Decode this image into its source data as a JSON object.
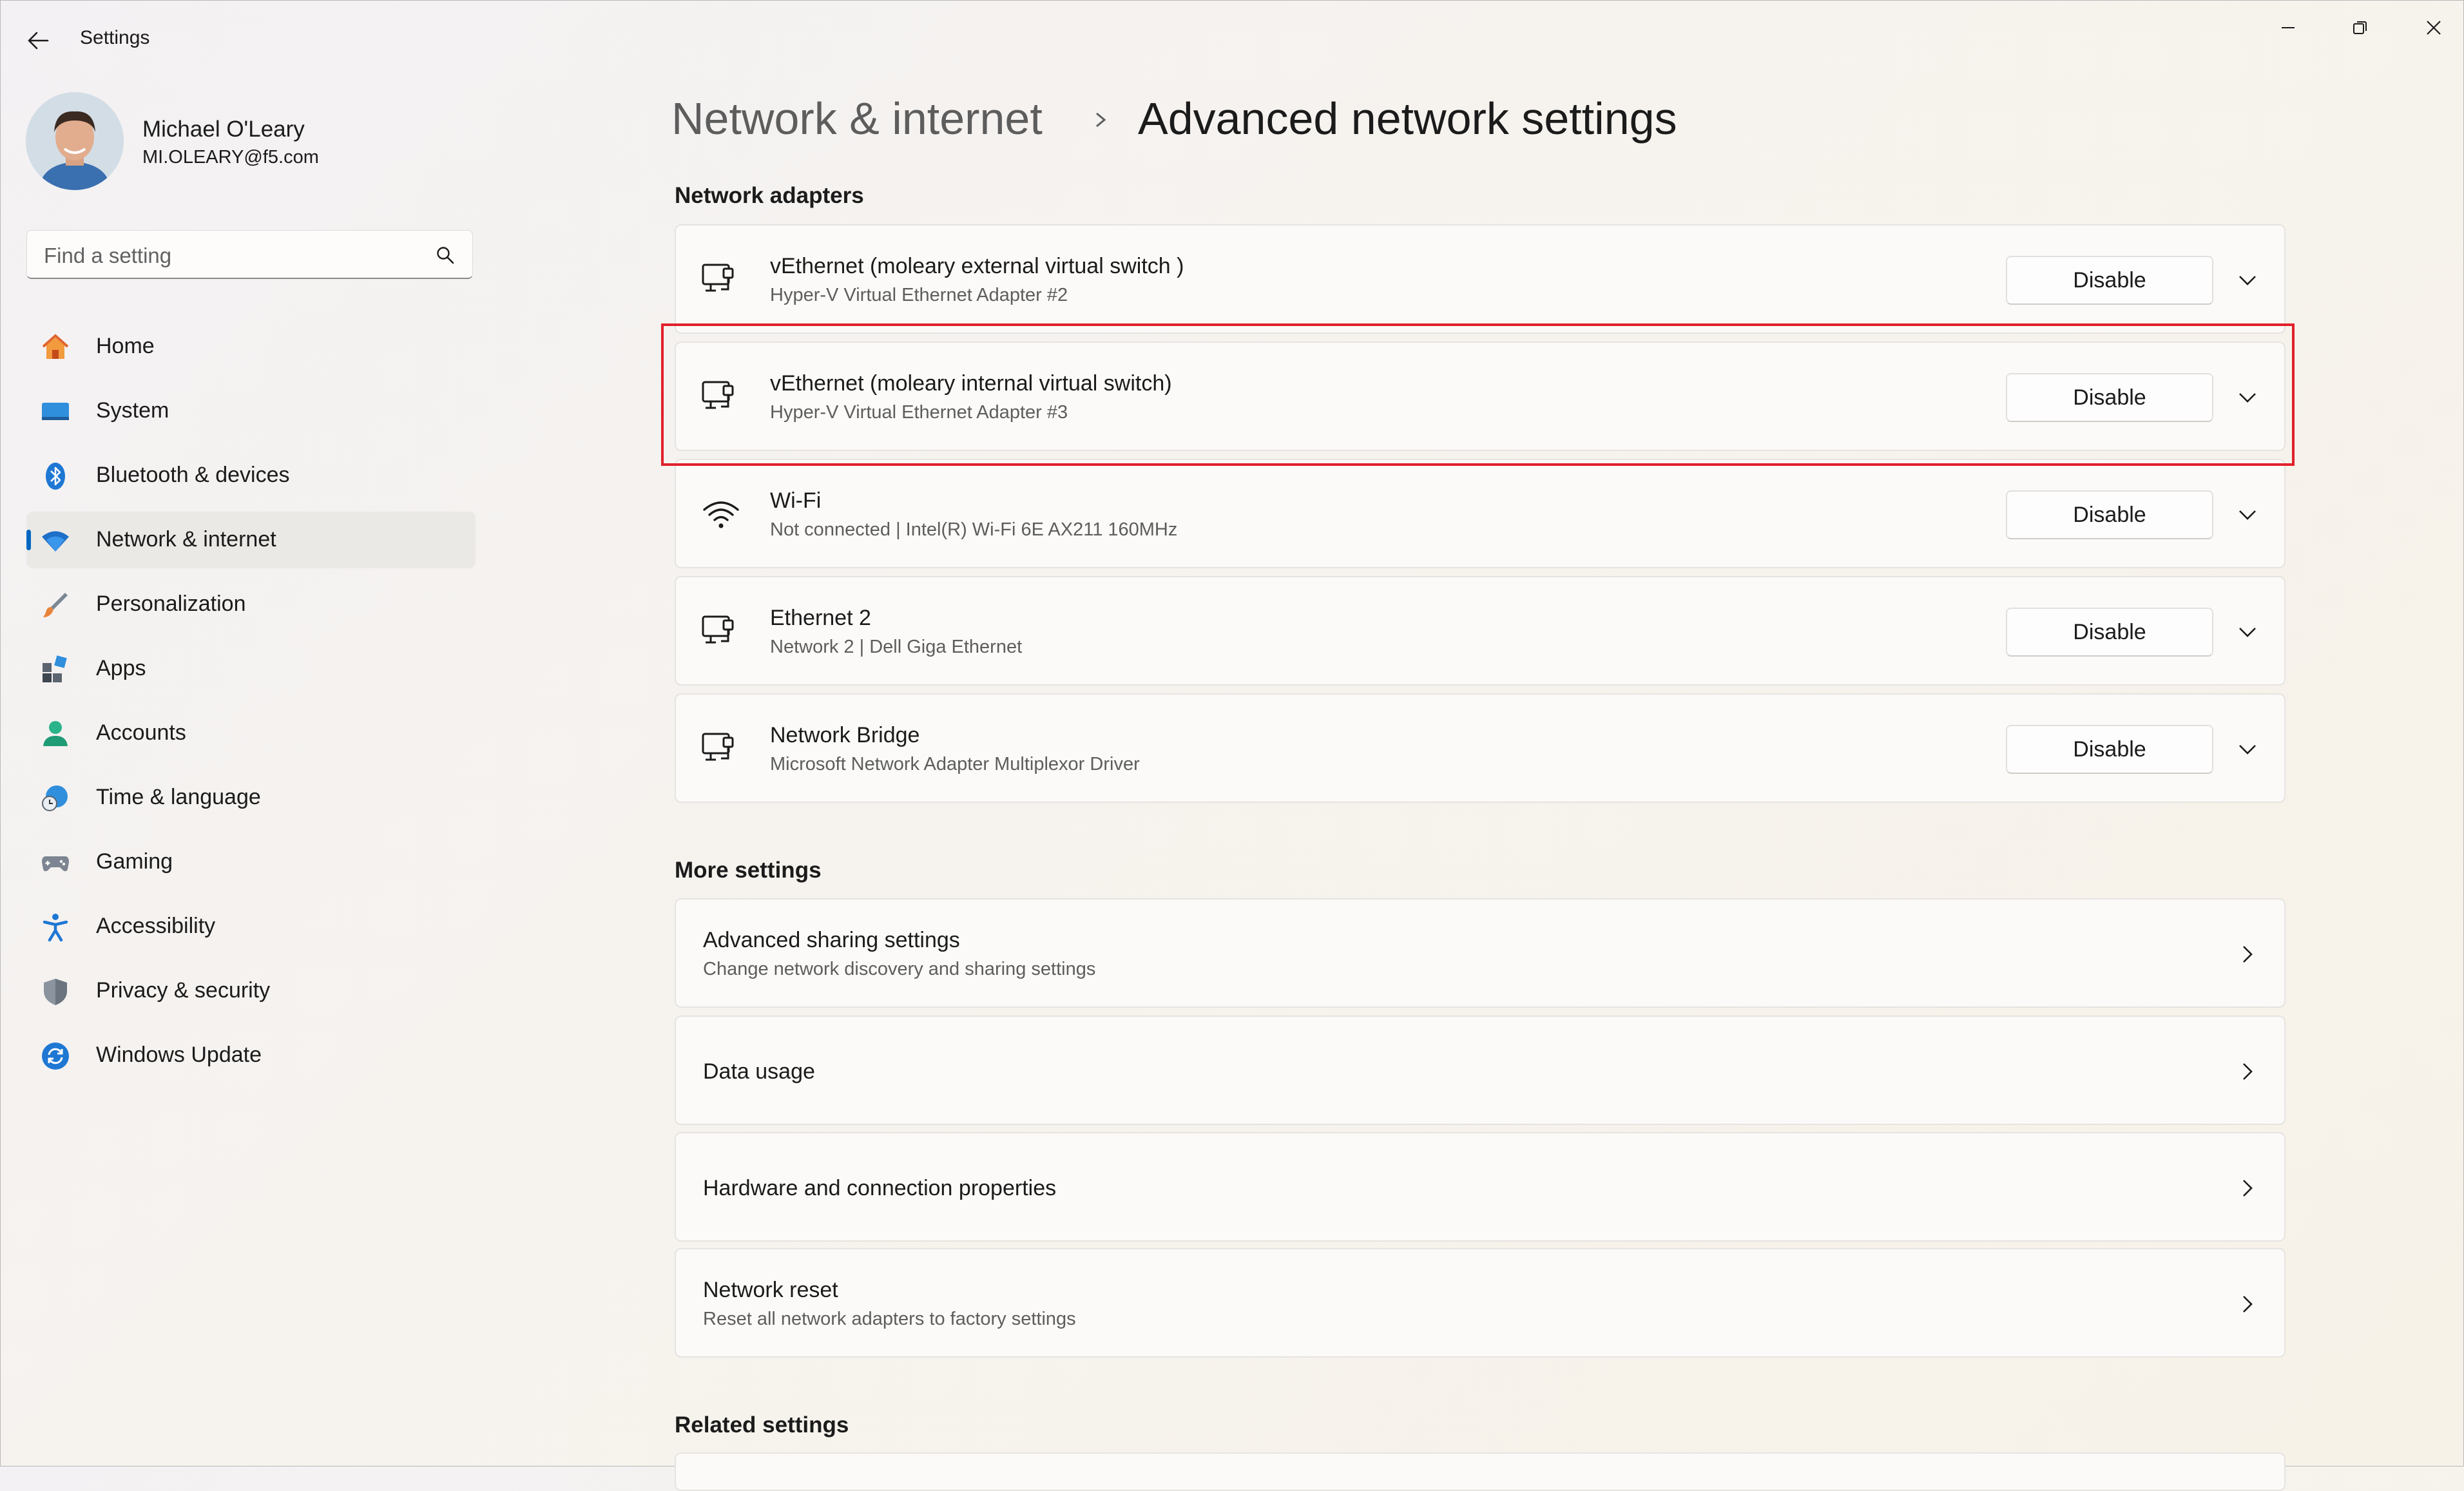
{
  "app": {
    "title": "Settings"
  },
  "user": {
    "name": "Michael O'Leary",
    "email": "MI.OLEARY@f5.com"
  },
  "search": {
    "placeholder": "Find a setting"
  },
  "nav": [
    {
      "label": "Home",
      "icon": "home-icon"
    },
    {
      "label": "System",
      "icon": "system-icon"
    },
    {
      "label": "Bluetooth & devices",
      "icon": "bluetooth-icon"
    },
    {
      "label": "Network & internet",
      "icon": "wifi-icon",
      "selected": true
    },
    {
      "label": "Personalization",
      "icon": "brush-icon"
    },
    {
      "label": "Apps",
      "icon": "apps-icon"
    },
    {
      "label": "Accounts",
      "icon": "accounts-icon"
    },
    {
      "label": "Time & language",
      "icon": "globe-clock-icon"
    },
    {
      "label": "Gaming",
      "icon": "gamepad-icon"
    },
    {
      "label": "Accessibility",
      "icon": "accessibility-icon"
    },
    {
      "label": "Privacy & security",
      "icon": "shield-icon"
    },
    {
      "label": "Windows Update",
      "icon": "update-icon"
    }
  ],
  "header": {
    "parent": "Network & internet",
    "current": "Advanced network settings"
  },
  "sections": {
    "adapters": "Network adapters",
    "more": "More settings",
    "related": "Related settings"
  },
  "adapters": [
    {
      "name": "vEthernet (moleary external virtual switch )",
      "desc": "Hyper-V Virtual Ethernet Adapter #2",
      "button": "Disable",
      "icon": "ethernet-adapter-icon"
    },
    {
      "name": "vEthernet (moleary internal virtual switch)",
      "desc": "Hyper-V Virtual Ethernet Adapter #3",
      "button": "Disable",
      "icon": "ethernet-adapter-icon",
      "highlighted": true
    },
    {
      "name": "Wi-Fi",
      "desc": "Not connected | Intel(R) Wi-Fi 6E AX211 160MHz",
      "button": "Disable",
      "icon": "wifi-icon"
    },
    {
      "name": "Ethernet 2",
      "desc": "Network 2 | Dell Giga Ethernet",
      "button": "Disable",
      "icon": "ethernet-adapter-icon"
    },
    {
      "name": "Network Bridge",
      "desc": "Microsoft Network Adapter Multiplexor Driver",
      "button": "Disable",
      "icon": "ethernet-adapter-icon"
    }
  ],
  "more_settings": [
    {
      "title": "Advanced sharing settings",
      "desc": "Change network discovery and sharing settings"
    },
    {
      "title": "Data usage",
      "desc": ""
    },
    {
      "title": "Hardware and connection properties",
      "desc": ""
    },
    {
      "title": "Network reset",
      "desc": "Reset all network adapters to factory settings"
    }
  ],
  "colors": {
    "accent": "#0067c0",
    "highlight": "#e0212b"
  }
}
